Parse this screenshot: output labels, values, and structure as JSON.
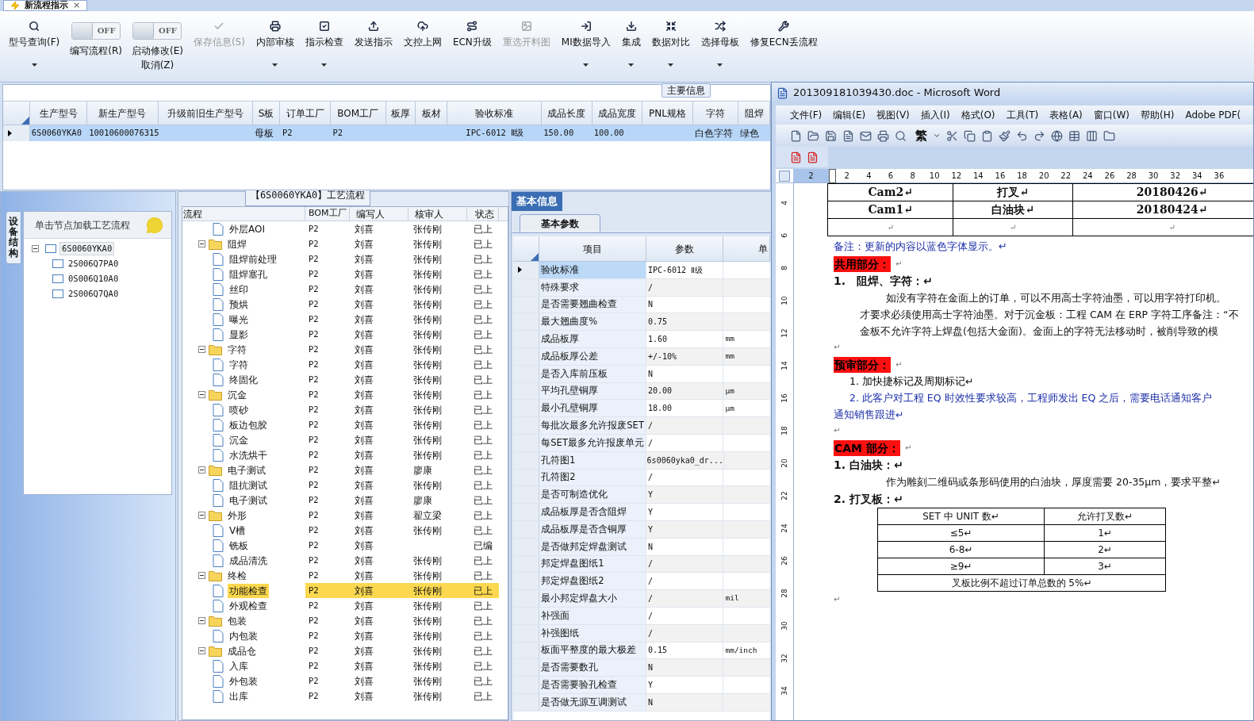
{
  "tab": {
    "title": "新流程指示",
    "close": "×"
  },
  "toolbar": [
    {
      "kind": "button",
      "label": "型号查询(F)",
      "disabled": false,
      "dropdown": true
    },
    {
      "kind": "toggle",
      "switch_text": "OFF",
      "on": false,
      "label": "编写流程(R)"
    },
    {
      "kind": "toggle",
      "switch_text": "OFF",
      "on": false,
      "label": "启动修改(E)",
      "label2": "取消(Z)"
    },
    {
      "kind": "button",
      "label": "保存信息(S)",
      "disabled": true,
      "dropdown": false
    },
    {
      "kind": "button",
      "label": "内部审核",
      "disabled": false,
      "dropdown": true
    },
    {
      "kind": "button",
      "label": "指示检查",
      "disabled": false,
      "dropdown": true
    },
    {
      "kind": "button",
      "label": "发送指示",
      "disabled": false,
      "dropdown": false
    },
    {
      "kind": "button",
      "label": "文控上网",
      "disabled": false,
      "dropdown": false
    },
    {
      "kind": "button",
      "label": "ECN升级",
      "disabled": false,
      "dropdown": false
    },
    {
      "kind": "button",
      "label": "重选开料图",
      "disabled": true,
      "dropdown": false
    },
    {
      "kind": "button",
      "label": "MI数据导入",
      "disabled": false,
      "dropdown": true
    },
    {
      "kind": "button",
      "label": "集成",
      "disabled": false,
      "dropdown": true
    },
    {
      "kind": "button",
      "label": "数据对比",
      "disabled": false,
      "dropdown": true
    },
    {
      "kind": "button",
      "label": "选择母板",
      "disabled": false,
      "dropdown": true
    },
    {
      "kind": "button",
      "label": "修复ECN丢流程",
      "disabled": false,
      "dropdown": false
    }
  ],
  "main_info": {
    "title": "主要信息",
    "columns": [
      "生产型号",
      "新生产型号",
      "升级前旧生产型号",
      "S板",
      "订单工厂",
      "BOM工厂",
      "板厚",
      "板材",
      "验收标准",
      "成品长度",
      "成品宽度",
      "PNL规格",
      "字符",
      "阻焊"
    ],
    "rows": [
      {
        "selected": true,
        "cells": [
          "6S0060YKA0",
          "10010600076315",
          null,
          "母板",
          "P2",
          "P2",
          null,
          null,
          "IPC-6012 Ⅱ级",
          "150.00",
          "100.00",
          null,
          "白色字符",
          "绿色"
        ]
      }
    ]
  },
  "device_panel": {
    "side_tab": "设备结构",
    "hint": "单击节点加载工艺流程",
    "tree": [
      {
        "name": "6S0060YKA0",
        "selected": true,
        "expanded": true,
        "children": [
          {
            "name": "2S006Q7PA0",
            "selected": false
          },
          {
            "name": "0S006Q10A0",
            "selected": false
          },
          {
            "name": "2S006Q7QA0",
            "selected": false
          }
        ]
      }
    ]
  },
  "process": {
    "title": "【6S0060YKA0】工艺流程",
    "columns": [
      "流程",
      "BOM工厂",
      "编写人",
      "核审人",
      "状态"
    ],
    "rows": [
      {
        "cells": [
          "外层AOI",
          "P2",
          "刘喜",
          "张传刚",
          "已上"
        ],
        "selected": false
      },
      {
        "cells": [
          "阻焊",
          "P2",
          "刘喜",
          "张传刚",
          "已上"
        ],
        "selected": false,
        "expanded": true,
        "children": [
          {
            "cells": [
              "阻焊前处理",
              "P2",
              "刘喜",
              "张传刚",
              "已上"
            ],
            "selected": false
          },
          {
            "cells": [
              "阻焊塞孔",
              "P2",
              "刘喜",
              "张传刚",
              "已上"
            ],
            "selected": false
          },
          {
            "cells": [
              "丝印",
              "P2",
              "刘喜",
              "张传刚",
              "已上"
            ],
            "selected": false
          },
          {
            "cells": [
              "预烘",
              "P2",
              "刘喜",
              "张传刚",
              "已上"
            ],
            "selected": false
          },
          {
            "cells": [
              "曝光",
              "P2",
              "刘喜",
              "张传刚",
              "已上"
            ],
            "selected": false
          },
          {
            "cells": [
              "显影",
              "P2",
              "刘喜",
              "张传刚",
              "已上"
            ],
            "selected": false
          }
        ]
      },
      {
        "cells": [
          "字符",
          "P2",
          "刘喜",
          "张传刚",
          "已上"
        ],
        "selected": false,
        "expanded": true,
        "children": [
          {
            "cells": [
              "字符",
              "P2",
              "刘喜",
              "张传刚",
              "已上"
            ],
            "selected": false
          },
          {
            "cells": [
              "终固化",
              "P2",
              "刘喜",
              "张传刚",
              "已上"
            ],
            "selected": false
          }
        ]
      },
      {
        "cells": [
          "沉金",
          "P2",
          "刘喜",
          "张传刚",
          "已上"
        ],
        "selected": false,
        "expanded": true,
        "children": [
          {
            "cells": [
              "喷砂",
              "P2",
              "刘喜",
              "张传刚",
              "已上"
            ],
            "selected": false
          },
          {
            "cells": [
              "板边包胶",
              "P2",
              "刘喜",
              "张传刚",
              "已上"
            ],
            "selected": false
          },
          {
            "cells": [
              "沉金",
              "P2",
              "刘喜",
              "张传刚",
              "已上"
            ],
            "selected": false
          },
          {
            "cells": [
              "水洗烘干",
              "P2",
              "刘喜",
              "张传刚",
              "已上"
            ],
            "selected": false
          }
        ]
      },
      {
        "cells": [
          "电子测试",
          "P2",
          "刘喜",
          "廖康",
          "已上"
        ],
        "selected": false,
        "expanded": true,
        "children": [
          {
            "cells": [
              "阻抗测试",
              "P2",
              "刘喜",
              "张传刚",
              "已上"
            ],
            "selected": false
          },
          {
            "cells": [
              "电子测试",
              "P2",
              "刘喜",
              "廖康",
              "已上"
            ],
            "selected": false
          }
        ]
      },
      {
        "cells": [
          "外形",
          "P2",
          "刘喜",
          "翟立梁",
          "已上"
        ],
        "selected": false,
        "expanded": true,
        "children": [
          {
            "cells": [
              "V槽",
              "P2",
              "刘喜",
              "张传刚",
              "已上"
            ],
            "selected": false
          },
          {
            "cells": [
              "铣板",
              "P2",
              "刘喜",
              null,
              "已编"
            ],
            "selected": false
          },
          {
            "cells": [
              "成品清洗",
              "P2",
              "刘喜",
              "张传刚",
              "已上"
            ],
            "selected": false
          }
        ]
      },
      {
        "cells": [
          "终检",
          "P2",
          "刘喜",
          "张传刚",
          "已上"
        ],
        "selected": false,
        "expanded": true,
        "children": [
          {
            "cells": [
              "功能检查",
              "P2",
              "刘喜",
              "张传刚",
              "已上"
            ],
            "selected": true
          },
          {
            "cells": [
              "外观检查",
              "P2",
              "刘喜",
              "张传刚",
              "已上"
            ],
            "selected": false
          }
        ]
      },
      {
        "cells": [
          "包装",
          "P2",
          "刘喜",
          "张传刚",
          "已上"
        ],
        "selected": false,
        "expanded": true,
        "children": [
          {
            "cells": [
              "内包装",
              "P2",
              "刘喜",
              "张传刚",
              "已上"
            ],
            "selected": false
          }
        ]
      },
      {
        "cells": [
          "成品仓",
          "P2",
          "刘喜",
          "张传刚",
          "已上"
        ],
        "selected": false,
        "expanded": true,
        "children": [
          {
            "cells": [
              "入库",
              "P2",
              "刘喜",
              "张传刚",
              "已上"
            ],
            "selected": false
          },
          {
            "cells": [
              "外包装",
              "P2",
              "刘喜",
              "张传刚",
              "已上"
            ],
            "selected": false
          },
          {
            "cells": [
              "出库",
              "P2",
              "刘喜",
              "张传刚",
              "已上"
            ],
            "selected": false
          }
        ]
      }
    ]
  },
  "basic_info": {
    "tab": "基本信息",
    "subtab": "基本参数",
    "columns": [
      "项目",
      "参数",
      "单"
    ],
    "rows": [
      {
        "item": "验收标准",
        "value": "IPC-6012 Ⅱ级",
        "unit": null,
        "selected": true
      },
      {
        "item": "特殊要求",
        "value": "/",
        "unit": null,
        "selected": false
      },
      {
        "item": "是否需要翘曲检查",
        "value": "N",
        "unit": null,
        "selected": false
      },
      {
        "item": "最大翘曲度%",
        "value": "0.75",
        "unit": null,
        "selected": false
      },
      {
        "item": "成品板厚",
        "value": "1.60",
        "unit": "mm",
        "selected": false
      },
      {
        "item": "成品板厚公差",
        "value": "+/-10%",
        "unit": "mm",
        "selected": false
      },
      {
        "item": "是否入库前压板",
        "value": "N",
        "unit": null,
        "selected": false
      },
      {
        "item": "平均孔壁铜厚",
        "value": "20.00",
        "unit": "μm",
        "selected": false
      },
      {
        "item": "最小孔壁铜厚",
        "value": "18.00",
        "unit": "μm",
        "selected": false
      },
      {
        "item": "每批次最多允许报废SET",
        "value": "/",
        "unit": null,
        "selected": false
      },
      {
        "item": "每SET最多允许报废单元",
        "value": "/",
        "unit": null,
        "selected": false
      },
      {
        "item": "孔符图1",
        "value": "6s0060yka0_dr...",
        "unit": null,
        "selected": false
      },
      {
        "item": "孔符图2",
        "value": "/",
        "unit": null,
        "selected": false
      },
      {
        "item": "是否可制造优化",
        "value": "Y",
        "unit": null,
        "selected": false
      },
      {
        "item": "成品板厚是否含阻焊",
        "value": "Y",
        "unit": null,
        "selected": false
      },
      {
        "item": "成品板厚是否含铜厚",
        "value": "Y",
        "unit": null,
        "selected": false
      },
      {
        "item": "是否做邦定焊盘测试",
        "value": "N",
        "unit": null,
        "selected": false
      },
      {
        "item": "邦定焊盘图纸1",
        "value": "/",
        "unit": null,
        "selected": false
      },
      {
        "item": "邦定焊盘图纸2",
        "value": "/",
        "unit": null,
        "selected": false
      },
      {
        "item": "最小邦定焊盘大小",
        "value": "/",
        "unit": "mil",
        "selected": false
      },
      {
        "item": "补强面",
        "value": "/",
        "unit": null,
        "selected": false
      },
      {
        "item": "补强图纸",
        "value": "/",
        "unit": null,
        "selected": false
      },
      {
        "item": "板面平整度的最大极差",
        "value": "0.15",
        "unit": "mm/inch",
        "selected": false
      },
      {
        "item": "是否需要数孔",
        "value": "N",
        "unit": null,
        "selected": false
      },
      {
        "item": "是否需要验孔检查",
        "value": "Y",
        "unit": null,
        "selected": false
      },
      {
        "item": "是否做无源互调测试",
        "value": "N",
        "unit": null,
        "selected": false
      }
    ]
  },
  "word": {
    "title": "201309181039430.doc - Microsoft Word",
    "menu": [
      "文件(F)",
      "编辑(E)",
      "视图(V)",
      "插入(I)",
      "格式(O)",
      "工具(T)",
      "表格(A)",
      "窗口(W)",
      "帮助(H)",
      "Adobe PDF("
    ],
    "toolbar_text": "繁",
    "ruler": [
      "2",
      "2",
      "4",
      "6",
      "8",
      "10",
      "12",
      "14",
      "16",
      "18",
      "20",
      "22",
      "24",
      "26",
      "28",
      "30",
      "32",
      "34",
      "36"
    ],
    "vruler": [
      "4",
      "6",
      "8",
      "10",
      "12",
      "14",
      "16",
      "18",
      "20",
      "22",
      "24",
      "26",
      "28",
      "30",
      "32",
      "34"
    ],
    "blocks": [
      {
        "kind": "table",
        "rows": [
          [
            "Cam2↵",
            "打叉↵",
            "20180426↵"
          ],
          [
            "Cam1↵",
            "白油块↵",
            "20180424↵"
          ],
          [
            "↵",
            "↵",
            "↵"
          ]
        ]
      },
      {
        "kind": "note",
        "text": "备注：更新的内容以蓝色字体显示。↵"
      },
      {
        "kind": "highlight",
        "text": "共用部分：",
        "mark": "↵"
      },
      {
        "kind": "heading",
        "text": "1.　阻焊、字符：↵"
      },
      {
        "kind": "body",
        "lines": [
          "如没有字符在金面上的订单，可以不用高士字符油墨，可以用字符打印机。",
          "才要求必须使用高士字符油墨。对于沉金板：工程 CAM 在 ERP 字符工序备注：“不",
          "金板不允许字符上焊盘(包括大金面)。金面上的字符无法移动时，被削导致的模"
        ]
      },
      {
        "kind": "blank",
        "text": "↵"
      },
      {
        "kind": "highlight",
        "text": "预审部分：",
        "mark": "↵"
      },
      {
        "kind": "list",
        "lines": [
          "1.  加快捷标记及周期标记↵"
        ]
      },
      {
        "kind": "list_blue",
        "lines": [
          "2.  此客户对工程 EQ 时效性要求较高，工程师发出 EQ 之后，需要电话通知客户",
          "通知销售跟进↵"
        ]
      },
      {
        "kind": "blank",
        "text": "↵"
      },
      {
        "kind": "highlight",
        "text": "CAM 部分：",
        "mark": "↵"
      },
      {
        "kind": "heading",
        "text": "1. 白油块：↵"
      },
      {
        "kind": "body",
        "lines": [
          "作为雕刻二维码或条形码使用的白油块，厚度需要 20-35μm，要求平整↵"
        ]
      },
      {
        "kind": "heading",
        "text": "2. 打叉板：↵"
      },
      {
        "kind": "grid",
        "rows": [
          [
            {
              "text": "SET 中 UNIT 数↵"
            },
            {
              "text": "允许打叉数↵"
            }
          ],
          [
            {
              "text": "≤5↵"
            },
            {
              "text": "1↵"
            }
          ],
          [
            {
              "text": "6-8↵"
            },
            {
              "text": "2↵"
            }
          ],
          [
            {
              "text": "≥9↵"
            },
            {
              "text": "3↵"
            }
          ],
          [
            {
              "text": "叉板比例不超过订单总数的 5%↵",
              "colspan": 2
            }
          ]
        ]
      },
      {
        "kind": "blank",
        "text": "↵"
      }
    ]
  }
}
